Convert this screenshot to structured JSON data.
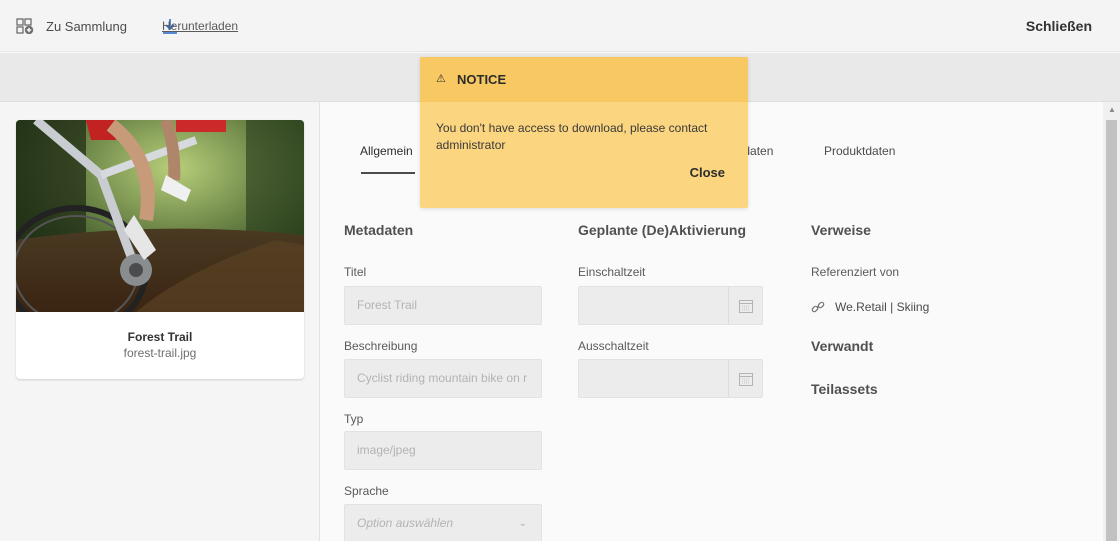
{
  "topbar": {
    "collection_label": "Zu Sammlung",
    "download_label": "Herunterladen",
    "close_label": "Schließen"
  },
  "asset": {
    "title": "Forest Trail",
    "filename": "forest-trail.jpg"
  },
  "tabs": {
    "general": "Allgemein",
    "metadata_partial": "eradaten",
    "product": "Produktdaten"
  },
  "metadata": {
    "heading": "Metadaten",
    "title_label": "Titel",
    "title_value": "Forest Trail",
    "description_label": "Beschreibung",
    "description_value": "Cyclist riding mountain bike on r",
    "type_label": "Typ",
    "type_value": "image/jpeg",
    "language_label": "Sprache",
    "language_placeholder": "Option auswählen"
  },
  "activation": {
    "heading": "Geplante (De)Aktivierung",
    "on_label": "Einschaltzeit",
    "off_label": "Ausschaltzeit"
  },
  "references": {
    "heading": "Verweise",
    "referenced_by_label": "Referenziert von",
    "reference_item": "We.Retail | Skiing",
    "related_heading": "Verwandt",
    "subassets_heading": "Teilassets"
  },
  "notice": {
    "warn_glyph": "⚠",
    "title": "NOTICE",
    "message": "You don't have access to download, please contact administrator",
    "close_label": "Close"
  },
  "colors": {
    "link_blue": "#2d6fc8",
    "notice_bg": "#fbd57f",
    "notice_header": "#f8c863"
  }
}
